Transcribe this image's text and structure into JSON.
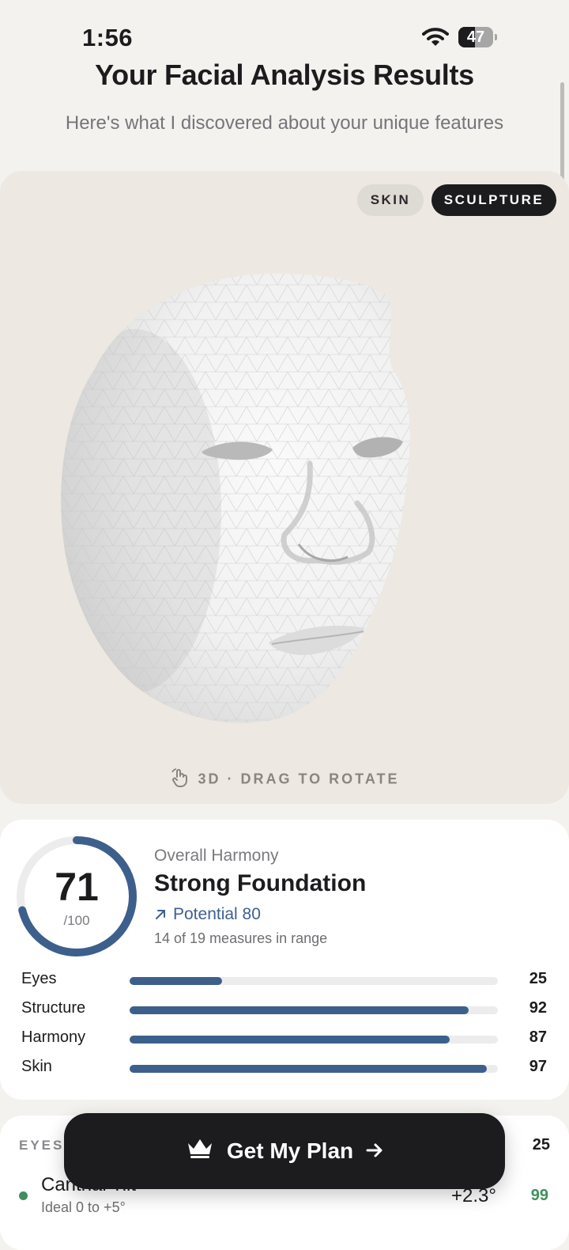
{
  "status_bar": {
    "time": "1:56",
    "battery_level": "47"
  },
  "header": {
    "title": "Your Facial Analysis Results",
    "subtitle": "Here's what I discovered about your unique features"
  },
  "viewer": {
    "modes": [
      "SKIN",
      "SCULPTURE"
    ],
    "active_mode": "SCULPTURE",
    "hint": "3D · DRAG TO ROTATE"
  },
  "overall": {
    "score": "71",
    "max": "/100",
    "score_fraction": 0.71,
    "label": "Overall Harmony",
    "title": "Strong Foundation",
    "potential": "Potential 80",
    "measures": "14 of 19 measures in range"
  },
  "metrics": [
    {
      "name": "Eyes",
      "value": "25",
      "percent": 25
    },
    {
      "name": "Structure",
      "value": "92",
      "percent": 92
    },
    {
      "name": "Harmony",
      "value": "87",
      "percent": 87
    },
    {
      "name": "Skin",
      "value": "97",
      "percent": 97
    }
  ],
  "detail": {
    "section": "EYES",
    "section_score": "25",
    "item_name": "Canthal Tilt",
    "item_ideal": "Ideal 0 to +5°",
    "item_value": "+2.3°",
    "item_score": "99",
    "status_color": "#3f8f5e"
  },
  "cta": {
    "label": "Get My Plan"
  },
  "colors": {
    "accent": "#3d5f8c",
    "good": "#3f8f5e",
    "dark": "#1c1c1e"
  }
}
